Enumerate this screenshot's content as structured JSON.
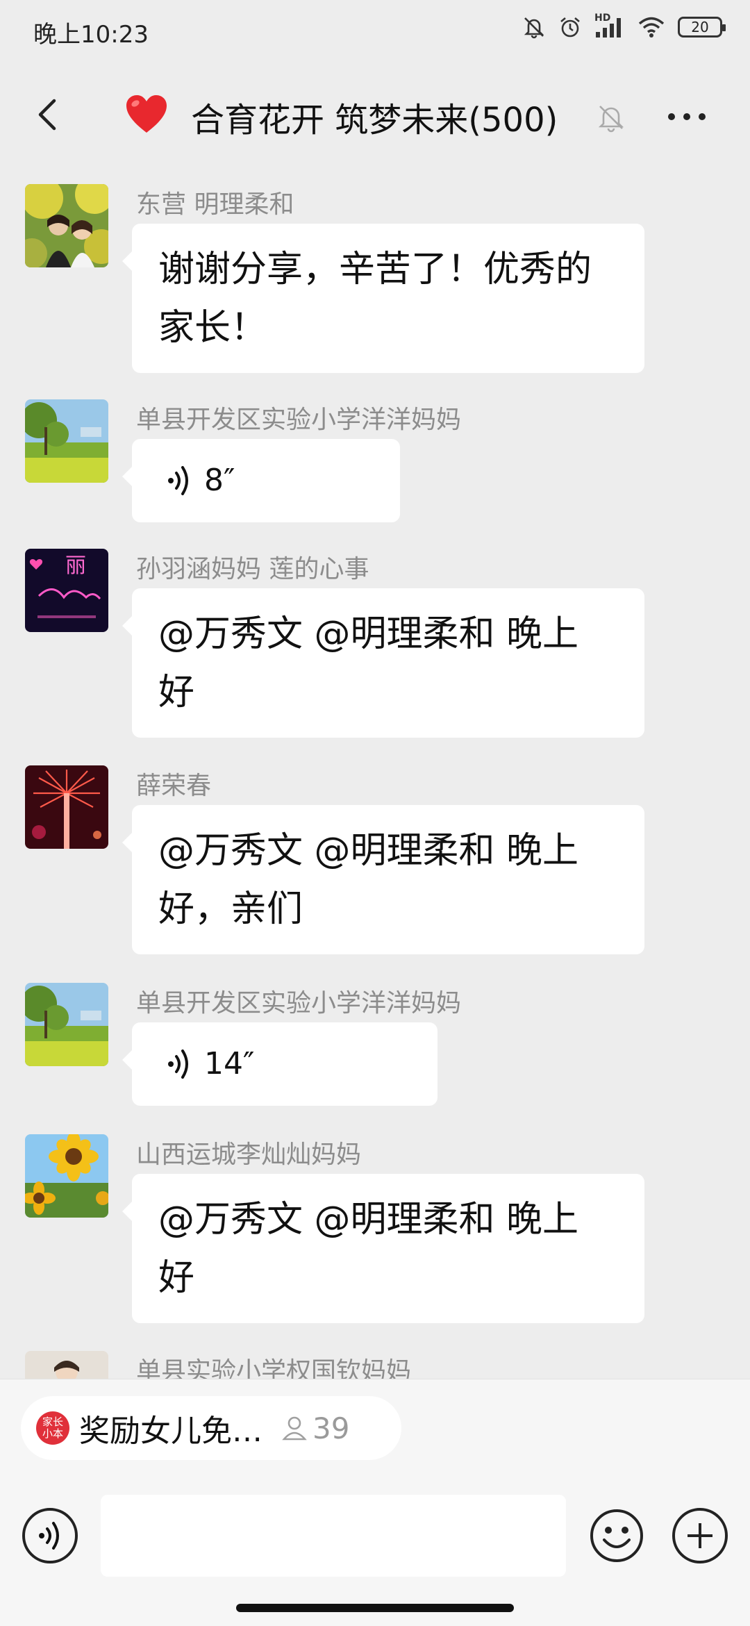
{
  "status_bar": {
    "time": "晚上10:23",
    "hd_label": "HD",
    "battery_level": "20"
  },
  "header": {
    "title": "合育花开 筑梦未来(500)"
  },
  "messages": [
    {
      "sender": "东营  明理柔和",
      "text_lines": [
        "谢谢分享，辛苦了！优秀的",
        "家长！"
      ]
    },
    {
      "sender": "单县开发区实验小学洋洋妈妈",
      "voice_duration": "8″"
    },
    {
      "sender": "孙羽涵妈妈  莲的心事",
      "text_lines": [
        "@万秀文 @明理柔和  晚上",
        "好"
      ]
    },
    {
      "sender": "薛荣春",
      "text_lines": [
        "@万秀文 @明理柔和  晚上",
        "好，亲们"
      ]
    },
    {
      "sender": "单县开发区实验小学洋洋妈妈",
      "voice_duration": "14″"
    },
    {
      "sender": "山西运城李灿灿妈妈",
      "text_lines": [
        "@万秀文 @明理柔和  晚上",
        "好"
      ]
    },
    {
      "sender": "单县实验小学权国钦妈妈"
    }
  ],
  "avatar_art": {
    "neon_char": "丽"
  },
  "pinned": {
    "logo_line1": "家长",
    "logo_line2": "小本",
    "title": "奖励女儿免…",
    "count": "39"
  },
  "input": {
    "placeholder": ""
  }
}
